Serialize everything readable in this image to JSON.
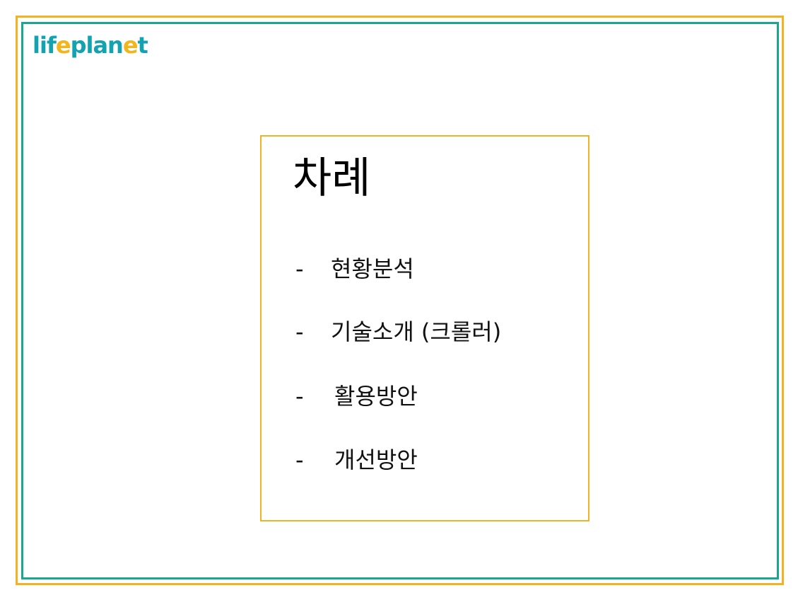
{
  "logo": {
    "part1": "lif",
    "part2": "e",
    "part3": "plan",
    "part4": "e",
    "part5": "t",
    "primary_color": "#13a3b0",
    "accent_color": "#f2b51e"
  },
  "frame": {
    "outer_color": "#f0b323",
    "inner_color": "#1aa68f"
  },
  "toc": {
    "title": "차례",
    "bullet": "-",
    "items": [
      "현황분석",
      "기술소개 (크롤러)",
      "활용방안",
      "개선방안"
    ]
  }
}
